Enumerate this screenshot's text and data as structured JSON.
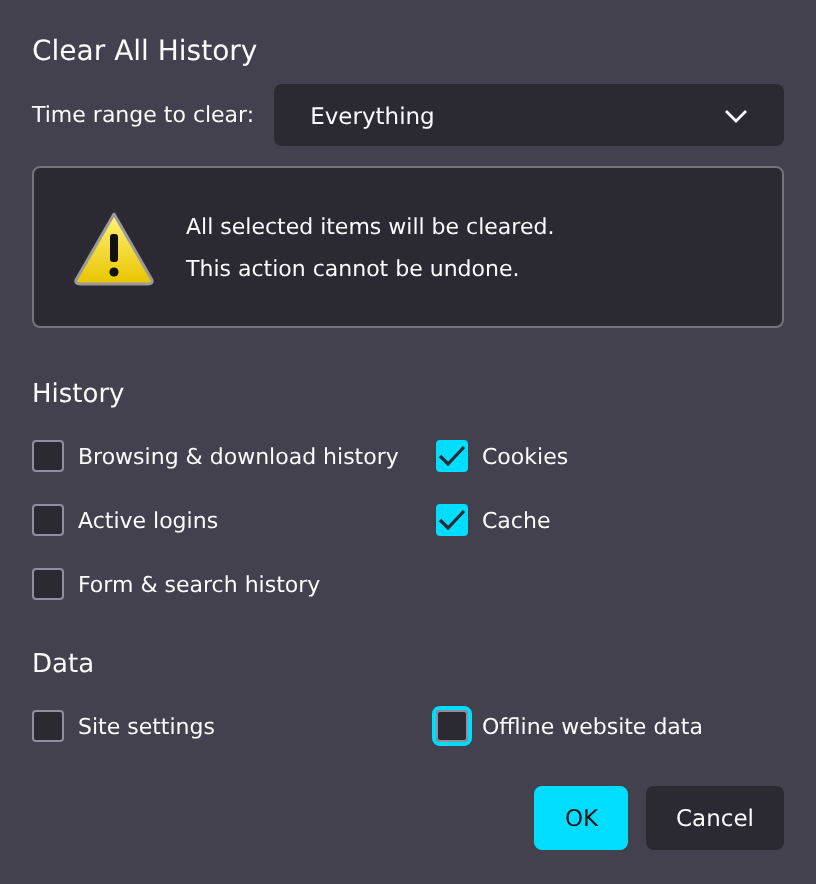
{
  "title": "Clear All History",
  "time_range": {
    "label": "Time range to clear:",
    "value": "Everything"
  },
  "warning": {
    "lines": [
      "All selected items will be cleared.",
      "This action cannot be undone."
    ]
  },
  "sections": [
    {
      "heading": "History",
      "items": [
        {
          "label": "Browsing & download history",
          "checked": false,
          "focused": false
        },
        {
          "label": "Cookies",
          "checked": true,
          "focused": false
        },
        {
          "label": "Active logins",
          "checked": false,
          "focused": false
        },
        {
          "label": "Cache",
          "checked": true,
          "focused": false
        },
        {
          "label": "Form & search history",
          "checked": false,
          "focused": false
        }
      ]
    },
    {
      "heading": "Data",
      "items": [
        {
          "label": "Site settings",
          "checked": false,
          "focused": false
        },
        {
          "label": "Offline website data",
          "checked": false,
          "focused": true
        }
      ]
    }
  ],
  "buttons": [
    {
      "label": "OK",
      "kind": "primary"
    },
    {
      "label": "Cancel",
      "kind": "secondary"
    }
  ]
}
